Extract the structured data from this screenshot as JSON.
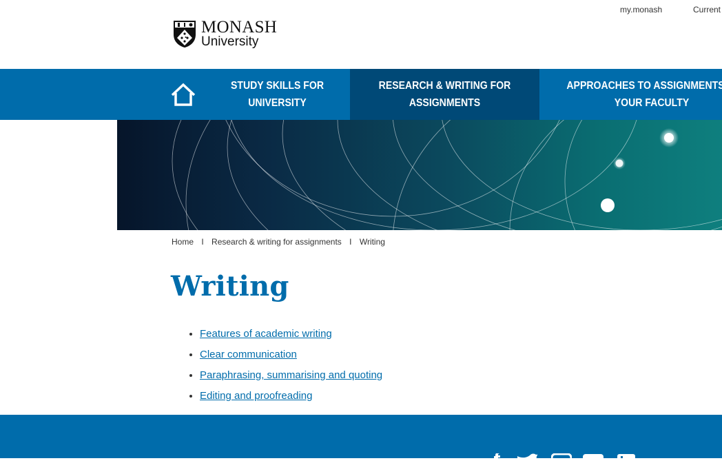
{
  "top_links": [
    "my.monash",
    "Current"
  ],
  "logo": {
    "line1": "MONASH",
    "line2": "University"
  },
  "nav": {
    "home_icon": "home-icon",
    "items": [
      {
        "label": "STUDY SKILLS FOR UNIVERSITY",
        "active": false
      },
      {
        "label": "RESEARCH & WRITING FOR ASSIGNMENTS",
        "active": true
      },
      {
        "label": "APPROACHES TO ASSIGNMENTS IN YOUR FACULTY",
        "active": false
      }
    ]
  },
  "breadcrumb": [
    "Home",
    "Research & writing for assignments",
    "Writing"
  ],
  "breadcrumb_separator": "I",
  "page_title": "Writing",
  "links": [
    "Features of academic writing",
    "Clear communication",
    "Paraphrasing, summarising and quoting",
    "Editing and proofreading"
  ],
  "footer": {
    "social_icons": [
      "facebook-icon",
      "twitter-icon",
      "instagram-icon",
      "youtube-icon",
      "linkedin-icon"
    ]
  },
  "colors": {
    "brand_blue": "#006cab",
    "nav_active": "#004977",
    "footer_blue": "#006cab"
  }
}
